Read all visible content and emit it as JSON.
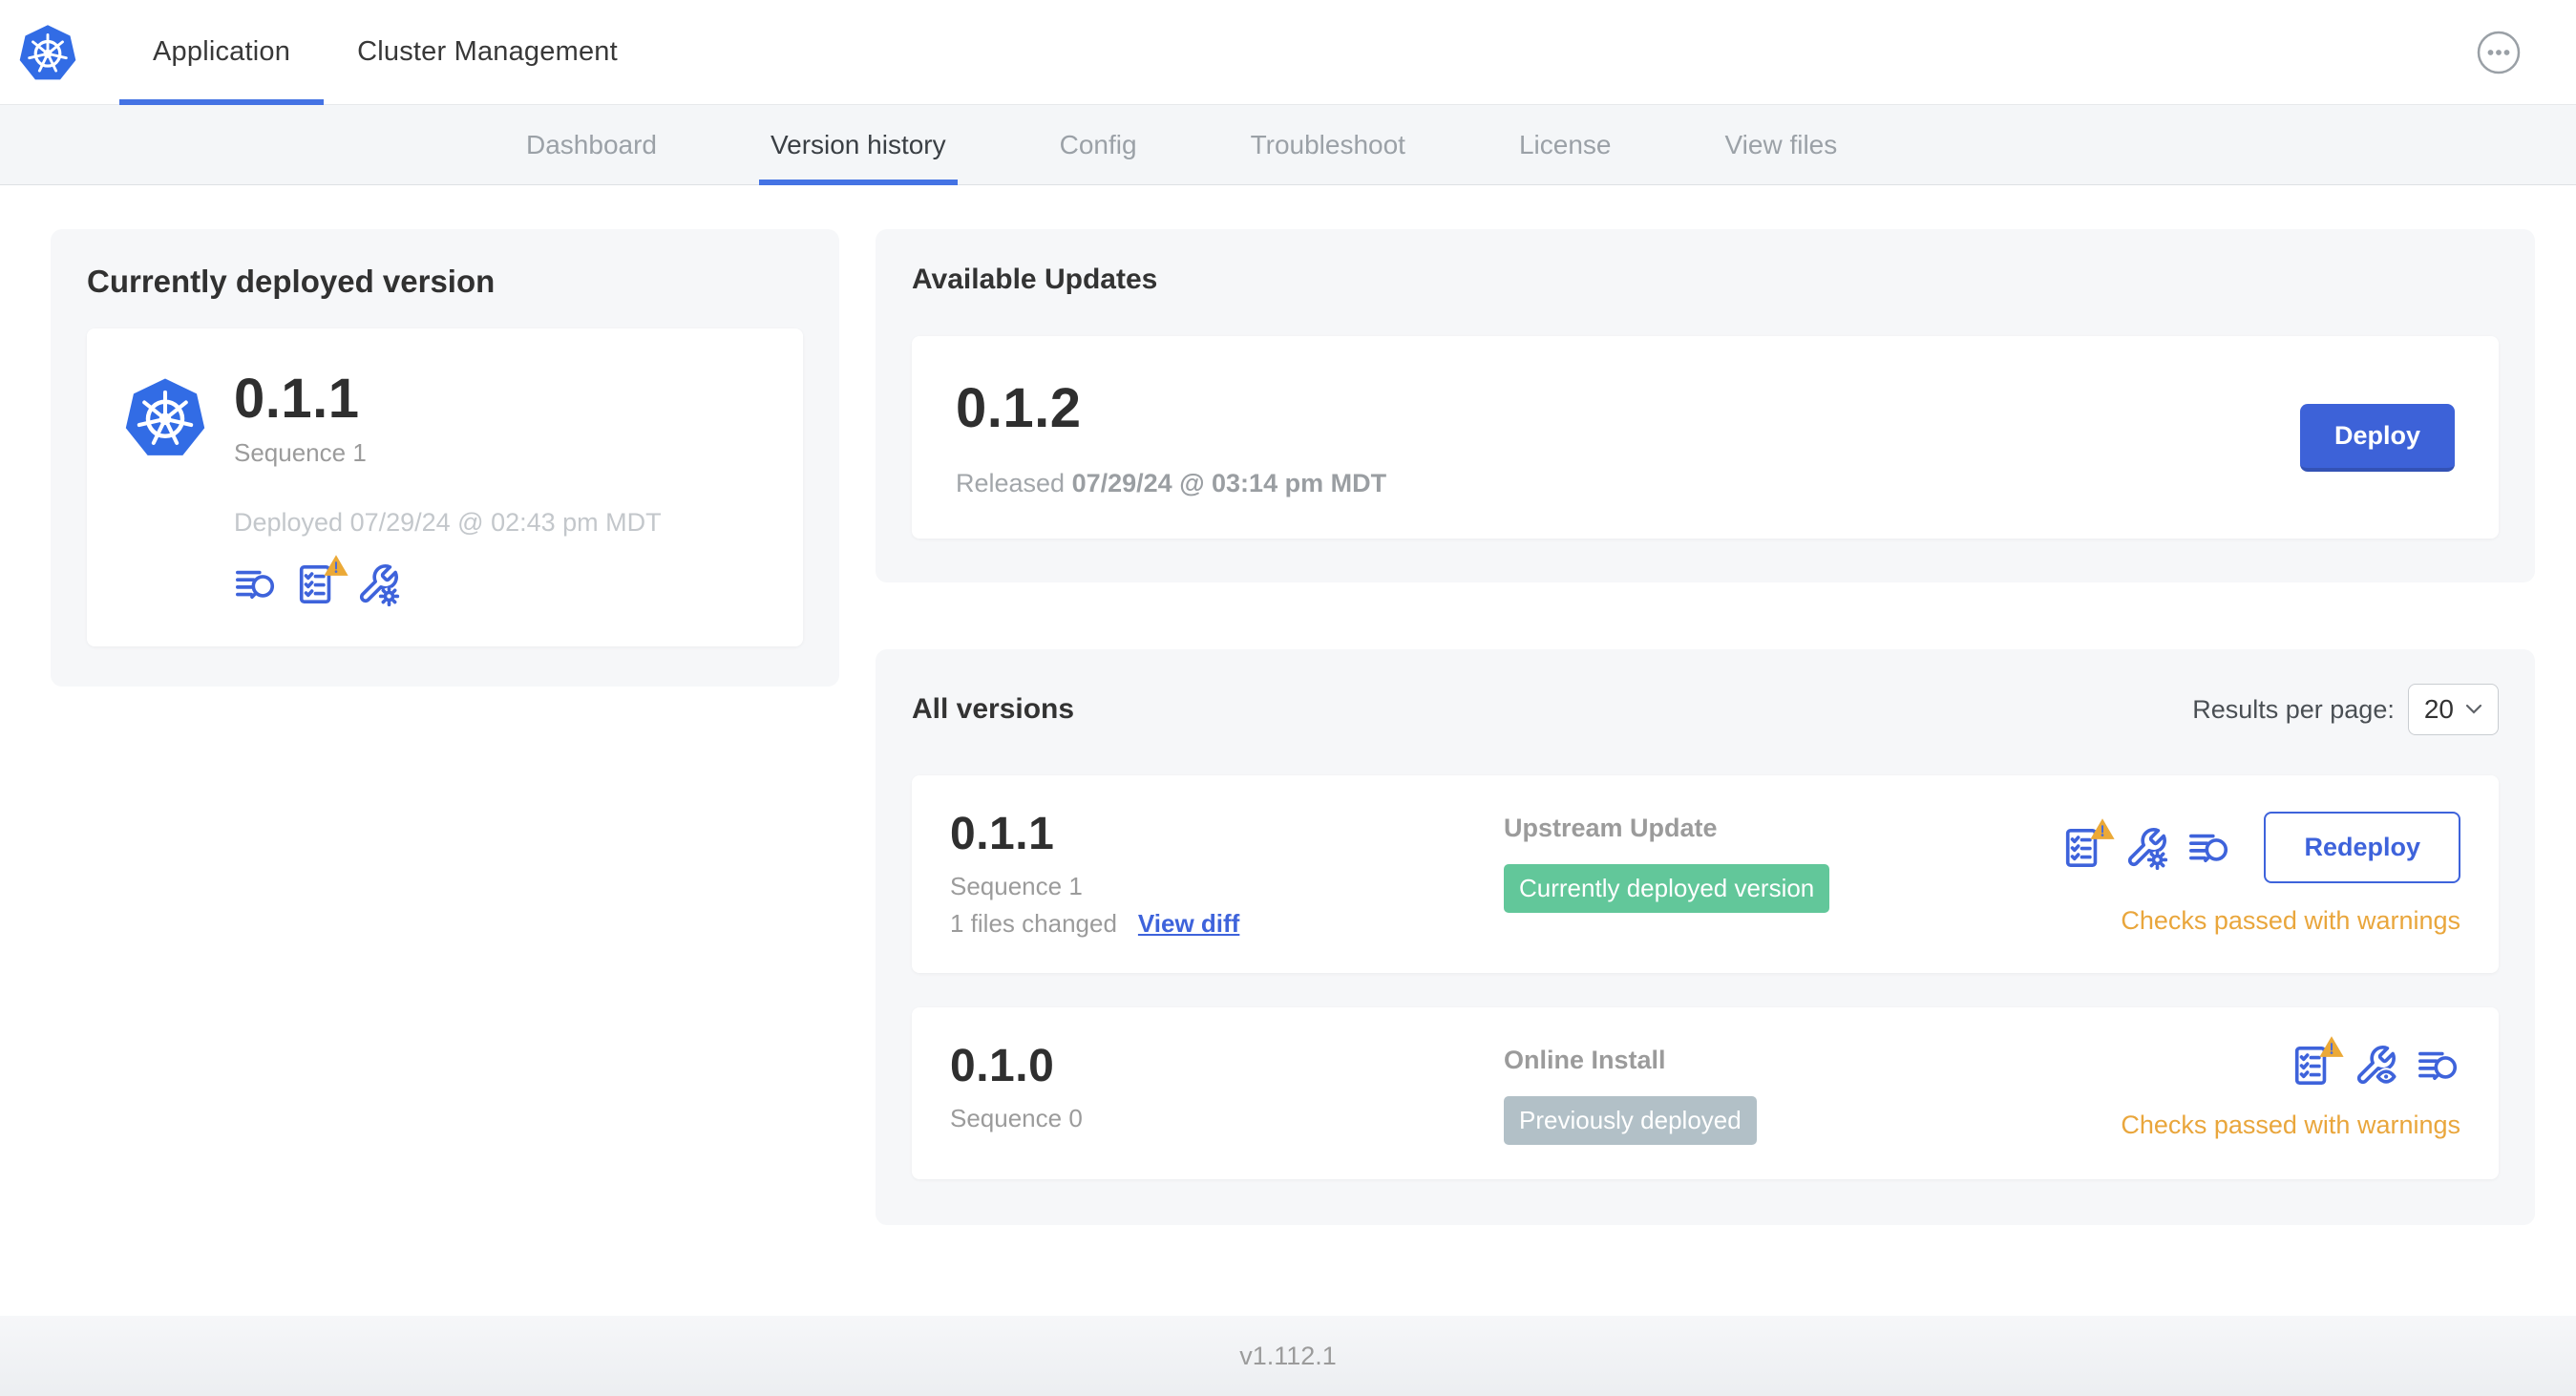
{
  "colors": {
    "k8s_blue": "#326CE5",
    "accent_blue": "#3E63DB",
    "tab_underline_blue": "#4473E4",
    "warning_orange": "#E9A63C",
    "warning_triangle": "#EBA937",
    "badge_green": "#62C79A",
    "badge_gray": "#B2C0C7",
    "card_background": "#F6F7F9"
  },
  "header": {
    "tabs": [
      {
        "label": "Application",
        "active": true
      },
      {
        "label": "Cluster Management",
        "active": false
      }
    ],
    "icons": [
      "kubernetes-logo-icon",
      "ellipsis-menu-icon"
    ]
  },
  "subnav": {
    "tabs": [
      {
        "label": "Dashboard",
        "active": false
      },
      {
        "label": "Version history",
        "active": true
      },
      {
        "label": "Config",
        "active": false
      },
      {
        "label": "Troubleshoot",
        "active": false
      },
      {
        "label": "License",
        "active": false
      },
      {
        "label": "View files",
        "active": false
      }
    ]
  },
  "current_version_card": {
    "title": "Currently deployed version",
    "version": "0.1.1",
    "sequence": "Sequence 1",
    "deployed": "Deployed 07/29/24 @ 02:43 pm MDT",
    "icons": [
      "logs-icon",
      "preflight-checks-warning-icon",
      "config-icon"
    ]
  },
  "available_updates": {
    "title": "Available Updates",
    "version": "0.1.2",
    "released_label": "Released",
    "released_value": "07/29/24 @ 03:14 pm MDT",
    "deploy_button": "Deploy"
  },
  "all_versions": {
    "title": "All versions",
    "results_per_page_label": "Results per page:",
    "results_per_page_value": "20",
    "rows": [
      {
        "version": "0.1.1",
        "sequence": "Sequence 1",
        "files_changed": "1 files changed",
        "view_diff_label": "View diff",
        "source": "Upstream Update",
        "badge": "Currently deployed version",
        "badge_color": "#62C79A",
        "status": "Checks passed with warnings",
        "action_button": "Redeploy",
        "icons": [
          "preflight-checks-warning-icon",
          "config-icon",
          "logs-icon"
        ]
      },
      {
        "version": "0.1.0",
        "sequence": "Sequence 0",
        "source": "Online Install",
        "badge": "Previously deployed",
        "badge_color": "#B2C0C7",
        "status": "Checks passed with warnings",
        "icons": [
          "preflight-checks-warning-icon",
          "view-config-icon",
          "logs-icon"
        ]
      }
    ]
  },
  "footer": {
    "app_version": "v1.112.1"
  }
}
